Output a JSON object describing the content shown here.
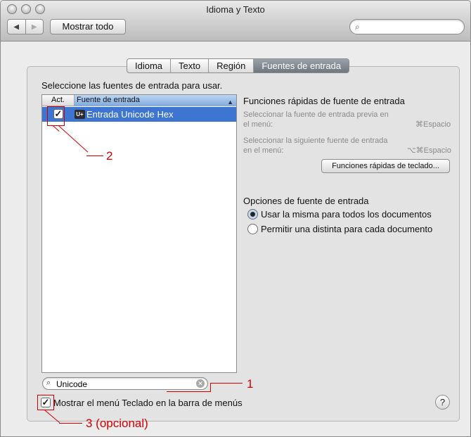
{
  "window": {
    "title": "Idioma y Texto"
  },
  "toolbar": {
    "back_glyph": "◀",
    "forward_glyph": "▶",
    "show_all_label": "Mostrar todo",
    "search_placeholder": ""
  },
  "tabs": [
    {
      "label": "Idioma"
    },
    {
      "label": "Texto"
    },
    {
      "label": "Región"
    },
    {
      "label": "Fuentes de entrada",
      "selected": true
    }
  ],
  "sources": {
    "heading": "Seleccione las fuentes de entrada para usar.",
    "col_active": "Act.",
    "col_source": "Fuente de entrada",
    "items": [
      {
        "icon_text": "U+",
        "label": "Entrada Unicode Hex",
        "checked": true
      }
    ],
    "search_value": "Unicode"
  },
  "shortcuts": {
    "heading": "Funciones rápidas de fuente de entrada",
    "prev_label_1": "Seleccionar la fuente de entrada previa en",
    "prev_label_2": "el menú:",
    "prev_keys": "⌘Espacio",
    "next_label_1": "Seleccionar la siguiente fuente de entrada",
    "next_label_2": "en el menú:",
    "next_keys": "⌥⌘Espacio",
    "button_label": "Funciones rápidas de teclado..."
  },
  "options": {
    "heading": "Opciones de fuente de entrada",
    "radio_same": "Usar la misma para todos los documentos",
    "radio_diff": "Permitir una distinta para cada documento",
    "selected": "radio_same"
  },
  "footer": {
    "show_menu_label": "Mostrar el menú Teclado en la barra de menús",
    "show_menu_checked": true,
    "help_label": "?"
  },
  "annotations": {
    "label_1": "1",
    "label_2": "2",
    "label_3": "3 (opcional)",
    "color": "#d40000"
  },
  "colors": {
    "selection": "#3d75d0",
    "tab_selected": "#7a818a"
  }
}
